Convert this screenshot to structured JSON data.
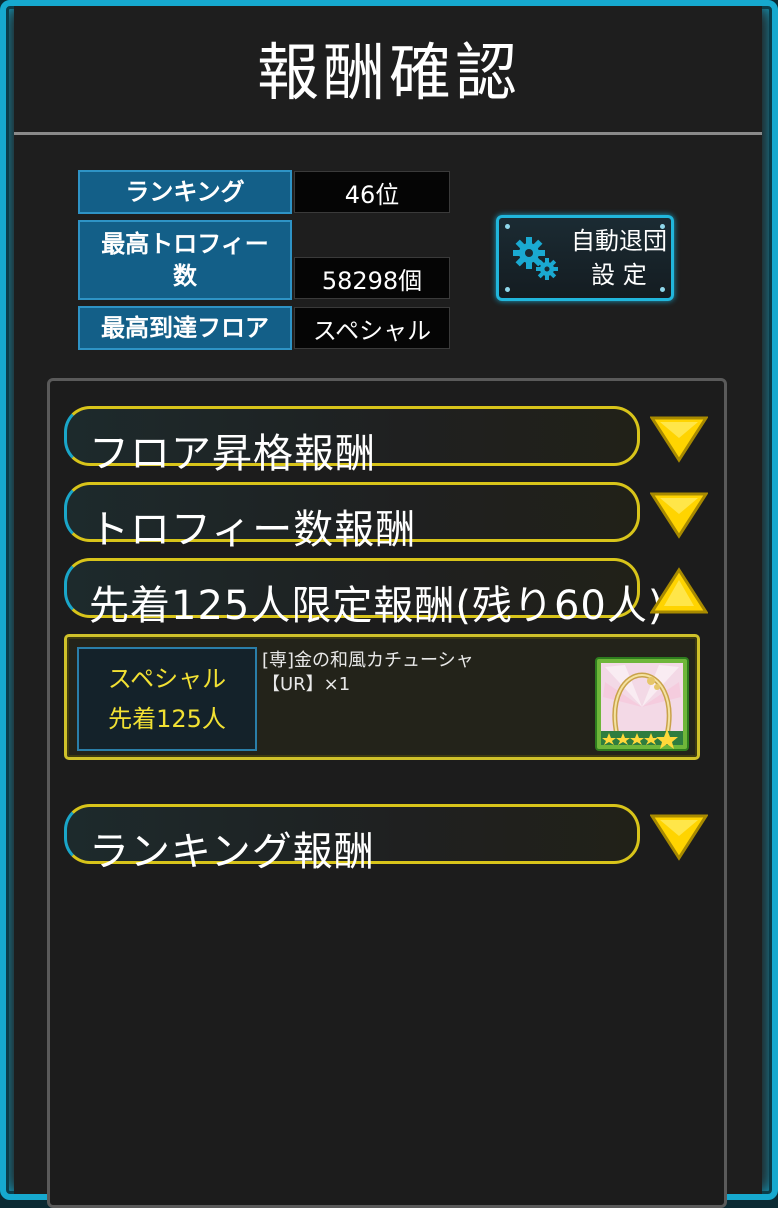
{
  "title": "報酬確認",
  "stats": [
    {
      "label": "ランキング",
      "value": "46位"
    },
    {
      "label": "最高トロフィー数",
      "value": "58298個"
    },
    {
      "label": "最高到達フロア",
      "value": "スペシャル"
    }
  ],
  "auto_leave_button": {
    "line1": "自動退団",
    "line2": "設 定"
  },
  "sections": {
    "floor_promotion": {
      "label": "フロア昇格報酬",
      "state": "collapsed"
    },
    "trophy_count": {
      "label": "トロフィー数報酬",
      "state": "collapsed"
    },
    "first_come": {
      "label": "先着125人限定報酬(残り60人)",
      "state": "expanded"
    },
    "ranking": {
      "label": "ランキング報酬",
      "state": "collapsed"
    }
  },
  "reward": {
    "tag_line1": "スペシャル",
    "tag_line2": "先着125人",
    "item_name": "[専]金の和風カチューシャ",
    "item_detail": "【UR】×1"
  },
  "colors": {
    "frame": "#16a9cf",
    "label_bg": "#135f88",
    "accent_yellow": "#f2e133",
    "arrow": "#ffd400"
  },
  "icons": [
    "gear-icon",
    "chevron-down-icon",
    "chevron-up-icon",
    "headband-item-icon"
  ]
}
